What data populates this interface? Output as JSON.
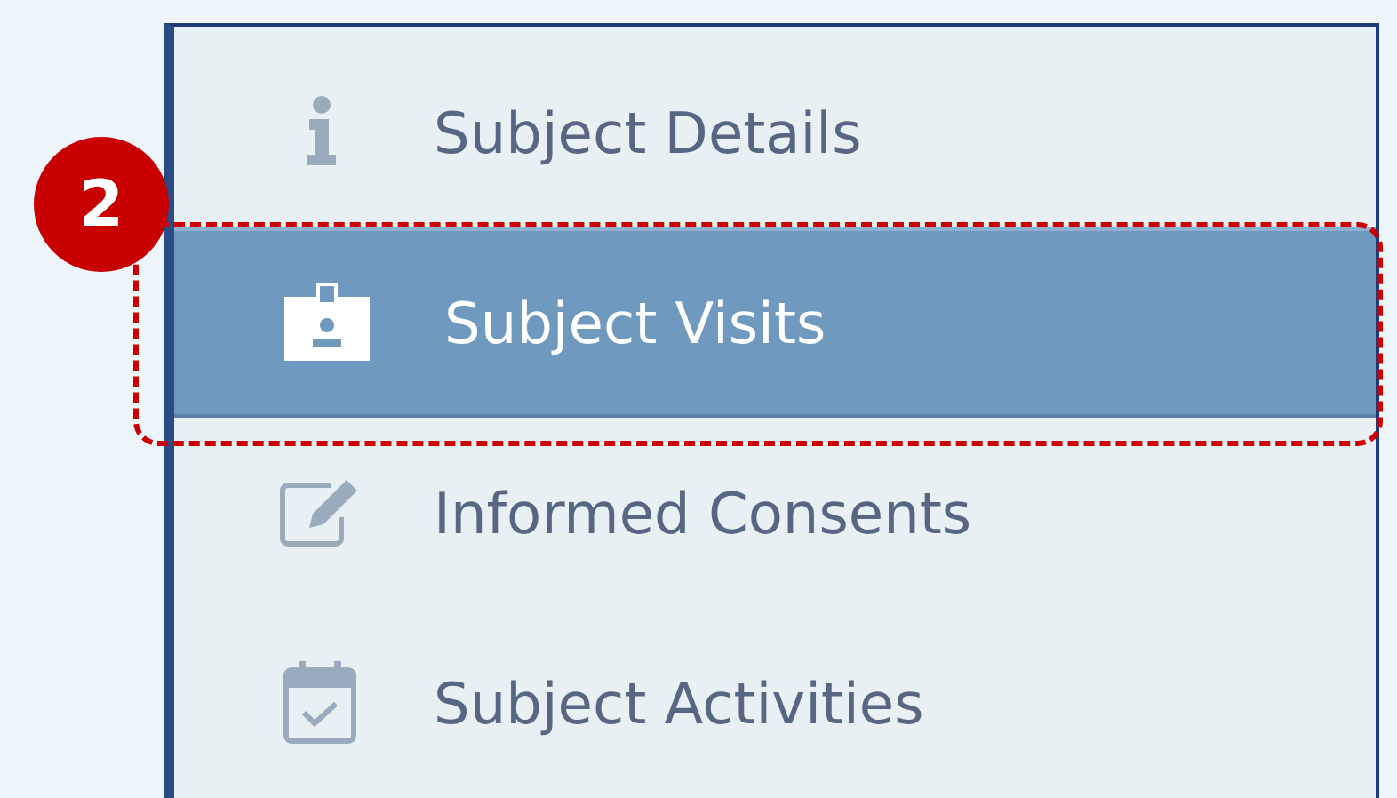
{
  "menu": {
    "items": [
      {
        "label": "Subject Details",
        "kind": "info",
        "selected": false
      },
      {
        "label": "Subject Visits",
        "kind": "badge",
        "selected": true
      },
      {
        "label": "Informed Consents",
        "kind": "edit",
        "selected": false
      },
      {
        "label": "Subject Activities",
        "kind": "calendar",
        "selected": false
      }
    ]
  },
  "callout": {
    "number": "2"
  }
}
